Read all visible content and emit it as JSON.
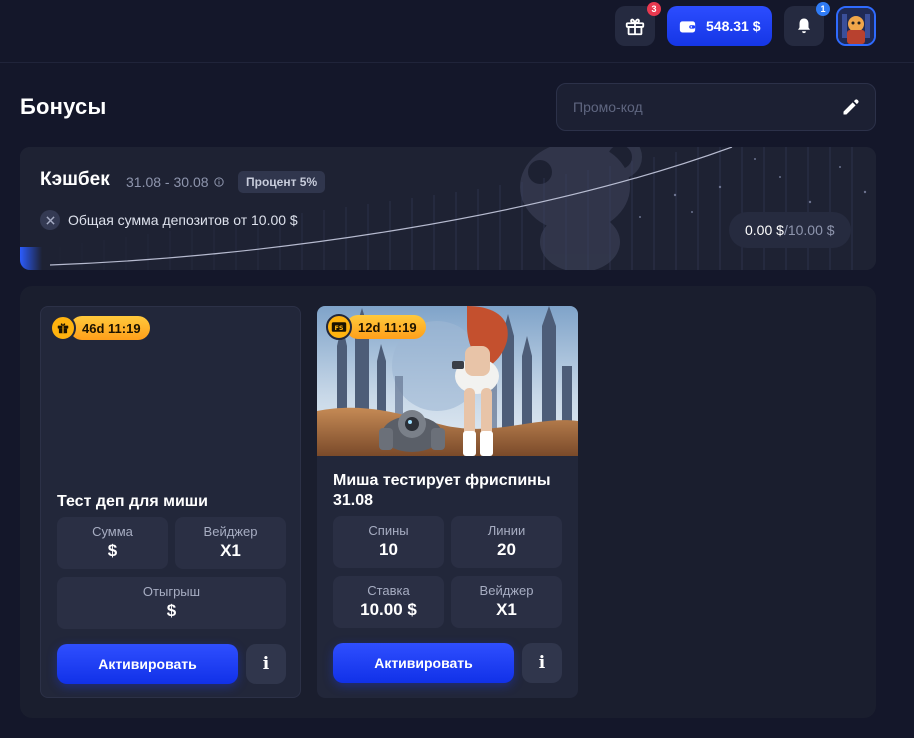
{
  "header": {
    "gift_badge": "3",
    "balance": "548.31 $",
    "notifications_badge": "1"
  },
  "page": {
    "title": "Бонусы",
    "promo_placeholder": "Промо-код"
  },
  "cashback": {
    "title": "Кэшбек",
    "dates": "31.08 - 30.08",
    "percent_tag": "Процент 5%",
    "condition": "Общая сумма депозитов от 10.00 $",
    "current": "0.00 $",
    "target": "/10.00 $",
    "progress": 0
  },
  "cards": [
    {
      "timer": "46d 11:19",
      "icon": "gift-icon",
      "name": "Тест деп для миши",
      "stats": [
        {
          "label": "Сумма",
          "value": "$"
        },
        {
          "label": "Вейджер",
          "value": "X1"
        },
        {
          "label": "Отыгрыш",
          "value": "$"
        }
      ],
      "activate_label": "Активировать",
      "info_label": "i"
    },
    {
      "timer": "12d 11:19",
      "icon": "freespins-icon",
      "icon_text": "FS",
      "name_line1": "Миша тестирует фриспины",
      "name_line2": "31.08",
      "stats": [
        {
          "label": "Спины",
          "value": "10"
        },
        {
          "label": "Линии",
          "value": "20"
        },
        {
          "label": "Ставка",
          "value": "10.00 $"
        },
        {
          "label": "Вейджер",
          "value": "X1"
        }
      ],
      "activate_label": "Активировать",
      "info_label": "i"
    }
  ],
  "colors": {
    "background": "#14172a",
    "accent_blue": "#1f3cff",
    "timer_yellow": "#ffb30f",
    "badge_red": "#e8384f"
  }
}
